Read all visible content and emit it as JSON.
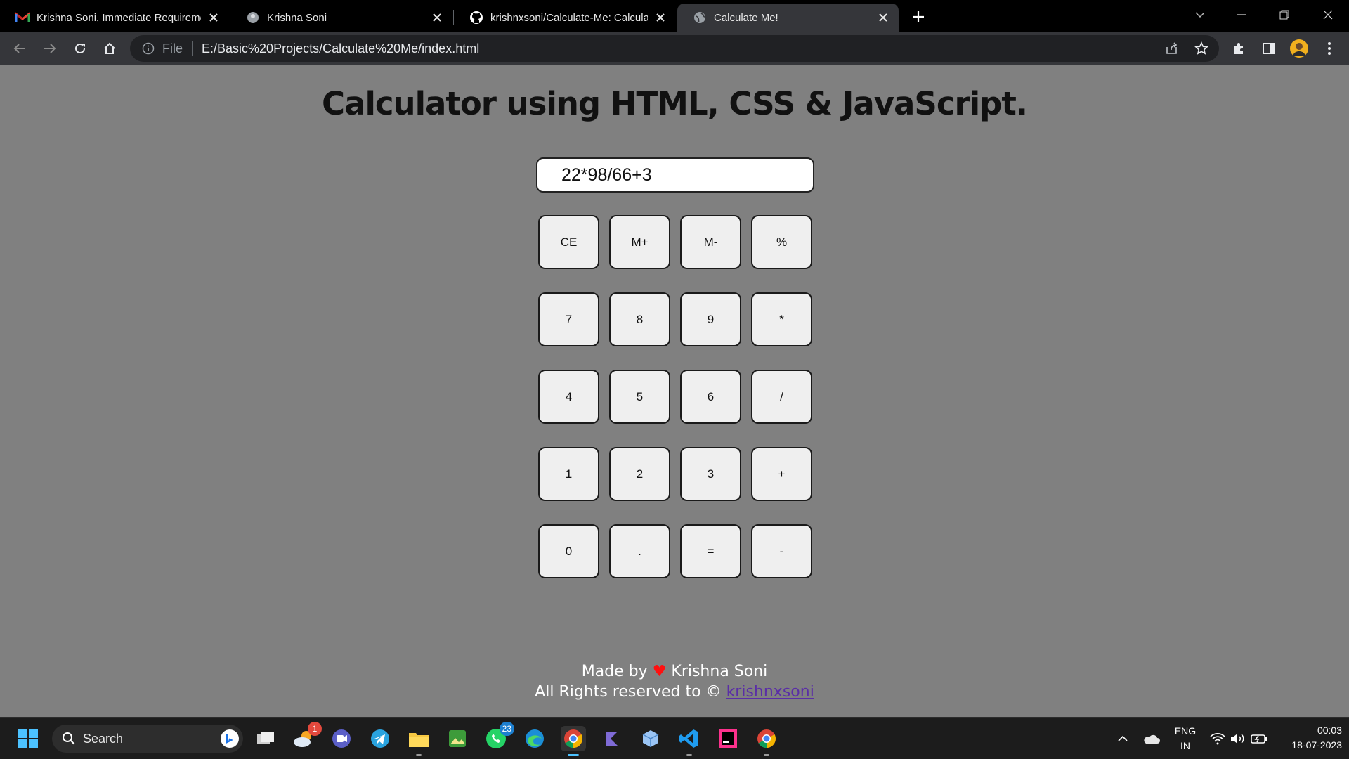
{
  "browser": {
    "tabs": [
      {
        "title": "Krishna Soni, Immediate Requirement",
        "icon": "gmail-icon"
      },
      {
        "title": "Krishna Soni",
        "icon": "profile-icon"
      },
      {
        "title": "krishnxsoni/Calculate-Me: Calculate",
        "icon": "github-icon"
      },
      {
        "title": "Calculate Me!",
        "icon": "globe-icon",
        "active": true
      }
    ],
    "address": {
      "scheme_label": "File",
      "url": "E:/Basic%20Projects/Calculate%20Me/index.html"
    }
  },
  "page": {
    "heading": "Calculator using HTML, CSS & JavaScript.",
    "display_value": "22*98/66+3",
    "keys": [
      [
        "CE",
        "M+",
        "M-",
        "%"
      ],
      [
        "7",
        "8",
        "9",
        "*"
      ],
      [
        "4",
        "5",
        "6",
        "/"
      ],
      [
        "1",
        "2",
        "3",
        "+"
      ],
      [
        "0",
        ".",
        "=",
        "-"
      ]
    ],
    "footer": {
      "made_by_prefix": "Made by",
      "heart": "♥",
      "author": "Krishna Soni",
      "rights_prefix": "All Rights reserved to ©",
      "link_text": "krishnxsoni"
    }
  },
  "taskbar": {
    "search_label": "Search",
    "badges": {
      "weather": "1",
      "whatsapp": "23"
    },
    "language": {
      "line1": "ENG",
      "line2": "IN"
    },
    "time": "00:03",
    "date": "18-07-2023"
  },
  "colors": {
    "page_bg": "#808080",
    "key_bg": "#efefef",
    "heart": "#ff1010",
    "link": "#5a2ea6",
    "tabbar_bg": "#000000",
    "toolbar_bg": "#35363a"
  }
}
